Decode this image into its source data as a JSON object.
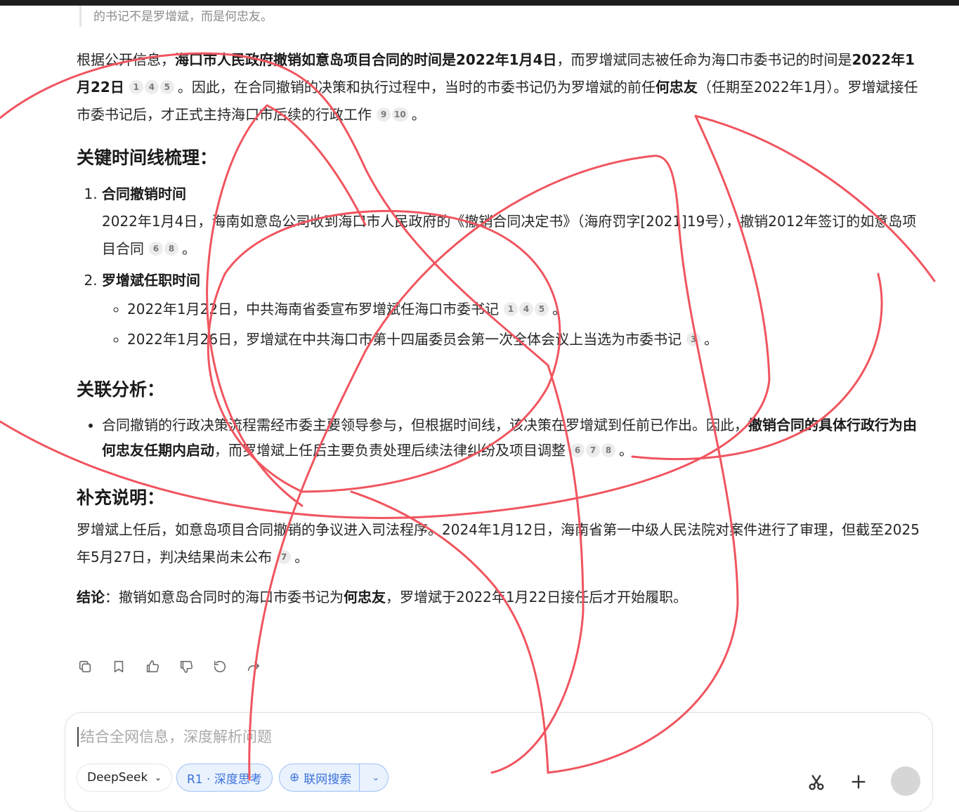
{
  "quote": "的书记不是罗增斌，而是何忠友。",
  "intro": {
    "p1": "根据公开信息，",
    "b1": "海口市人民政府撤销如意岛项目合同的时间是2022年1月4日",
    "p2": "，而罗增斌同志被任命为海口市委书记的时间是",
    "b2": "2022年1月22日",
    "cites1": [
      "1",
      "4",
      "5"
    ],
    "p3": "。因此，在合同撤销的决策和执行过程中，当时的市委书记仍为罗增斌的前任",
    "b3": "何忠友",
    "p4": "（任期至2022年1月）。罗增斌接任市委书记后，才正式主持海口市后续的行政工作",
    "cites2": [
      "9",
      "10"
    ],
    "p5": "。"
  },
  "timeline": {
    "heading": "关键时间线梳理：",
    "item1_title": "合同撤销时间",
    "item1_text": "2022年1月4日，海南如意岛公司收到海口市人民政府的《撤销合同决定书》（海府罚字[2021]19号），撤销2012年签订的如意岛项目合同",
    "item1_cites": [
      "6",
      "8"
    ],
    "item2_title": "罗增斌任职时间",
    "sub1_text": "2022年1月22日，中共海南省委宣布罗增斌任海口市委书记",
    "sub1_cites": [
      "1",
      "4",
      "5"
    ],
    "sub2_text": "2022年1月26日，罗增斌在中共海口市第十四届委员会第一次全体会议上当选为市委书记",
    "sub2_cites": [
      "3"
    ],
    "period": "。"
  },
  "analysis": {
    "heading": "关联分析：",
    "t1": "合同撤销的行政决策流程需经市委主要领导参与，但根据时间线，该决策在罗增斌到任前已作出。因此，",
    "b1": "撤销合同的具体行政行为由何忠友任期内启动",
    "t2": "，而罗增斌上任后主要负责处理后续法律纠纷及项目调整",
    "cites": [
      "6",
      "7",
      "8"
    ],
    "period": "。"
  },
  "supplement": {
    "heading": "补充说明：",
    "text": "罗增斌上任后，如意岛项目合同撤销的争议进入司法程序。2024年1月12日，海南省第一中级人民法院对案件进行了审理，但截至2025年5月27日，判决结果尚未公布",
    "cites": [
      "7"
    ],
    "period": "。"
  },
  "conclusion": {
    "label": "结论",
    "t1": "：撤销如意岛合同时的海口市委书记为",
    "b1": "何忠友",
    "t2": "，罗增斌于2022年1月22日接任后才开始履职。"
  },
  "actions": [
    "copy-icon",
    "bookmark-icon",
    "thumbs-up-icon",
    "thumbs-down-icon",
    "regenerate-icon",
    "share-icon"
  ],
  "composer": {
    "placeholder": "结合全网信息，深度解析问题",
    "model_label": "DeepSeek",
    "think_label": "R1 · 深度思考",
    "search_label": "联网搜索"
  },
  "colors": {
    "annotation_stroke": "#f0555f",
    "accent": "#3b72d9"
  }
}
